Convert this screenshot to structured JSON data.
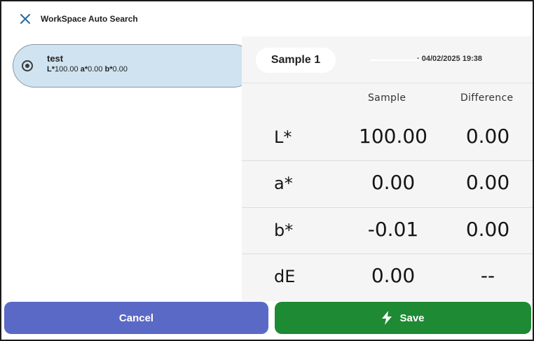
{
  "window": {
    "title": "WorkSpace Auto Search",
    "close_icon": "close-icon"
  },
  "results": [
    {
      "name": "test",
      "l_label": "L*",
      "l_value": "100.00",
      "a_label": "a*",
      "a_value": "0.00",
      "b_label": "b*",
      "b_value": "0.00",
      "selected": true
    }
  ],
  "sample": {
    "name": "Sample 1",
    "timestamp": "· 04/02/2025 19:38"
  },
  "table": {
    "col_sample": "Sample",
    "col_difference": "Difference",
    "rows": [
      {
        "label": "L*",
        "sample": "100.00",
        "difference": "0.00"
      },
      {
        "label": "a*",
        "sample": "0.00",
        "difference": "0.00"
      },
      {
        "label": "b*",
        "sample": "-0.01",
        "difference": "0.00"
      },
      {
        "label": "dE",
        "sample": "0.00",
        "difference": "--"
      }
    ]
  },
  "buttons": {
    "cancel": "Cancel",
    "save": "Save",
    "save_icon": "lightning-icon"
  },
  "colors": {
    "selected_item": "#cfe3f0",
    "cancel": "#5b69c6",
    "save": "#1e8a33",
    "close_icon": "#2f6f9f"
  }
}
